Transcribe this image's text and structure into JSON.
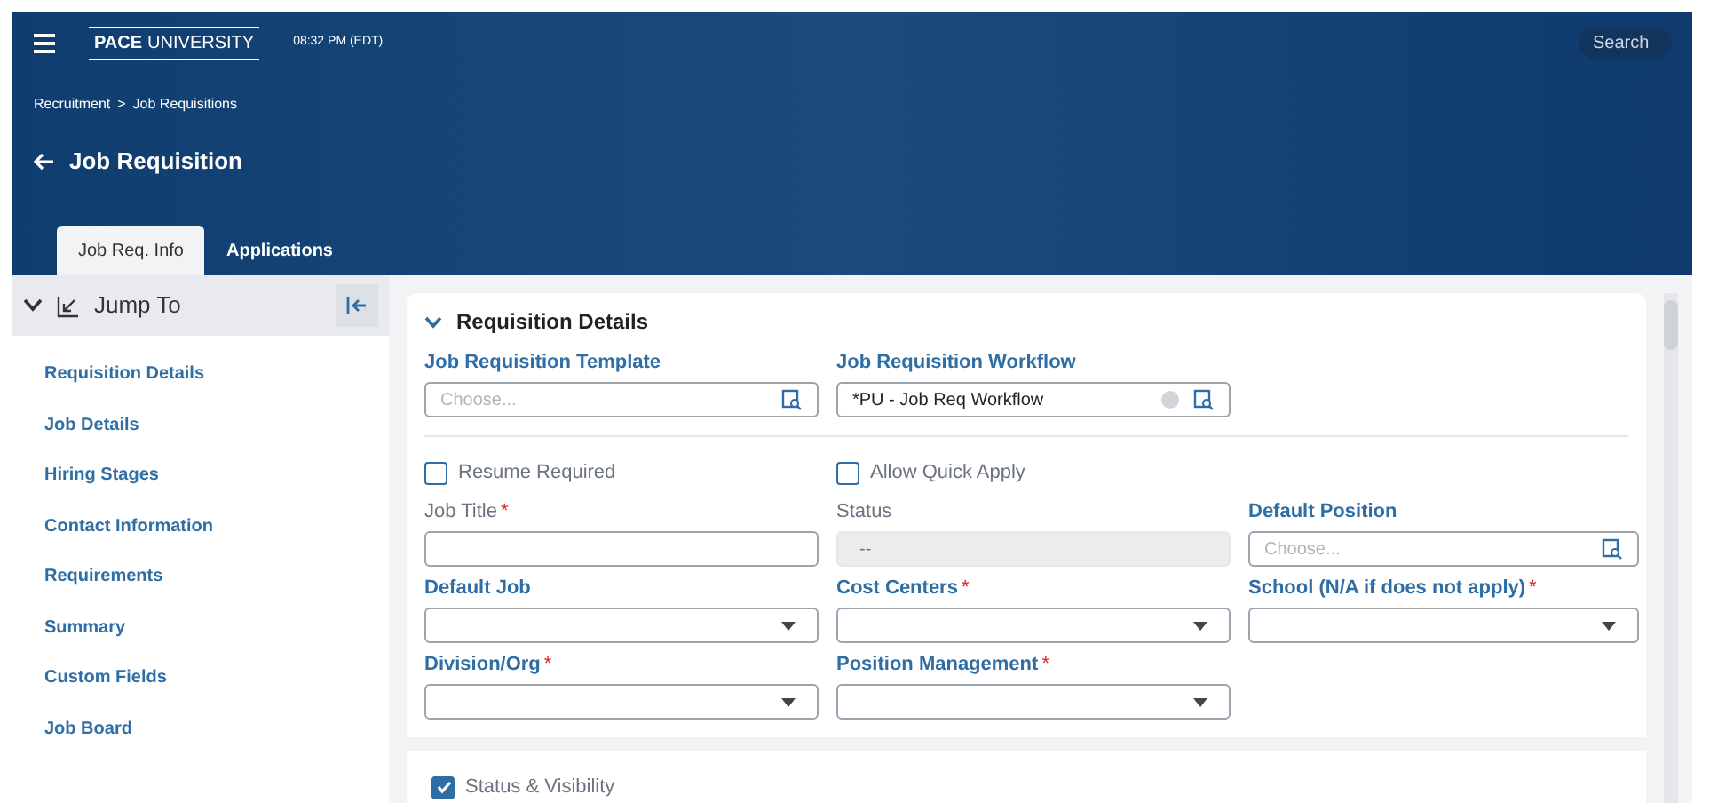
{
  "header": {
    "logo_bold": "PACE",
    "logo_rest": "UNIVERSITY",
    "time": "08:32 PM (EDT)",
    "search": {
      "placeholder": "Search"
    },
    "breadcrumb": [
      "Recruitment",
      ">",
      "Job Requisitions"
    ],
    "title": "Job Requisition"
  },
  "tabs": [
    {
      "label": "Job Req. Info",
      "selected": true
    },
    {
      "label": "Applications",
      "selected": false
    }
  ],
  "sidebar": {
    "title": "Jump To",
    "expanded": true,
    "items": [
      "Requisition Details",
      "Job Details",
      "Hiring Stages",
      "Contact Information",
      "Requirements",
      "Summary",
      "Custom Fields",
      "Job Board"
    ]
  },
  "section": {
    "title": "Requisition Details",
    "expanded": true,
    "rows": [
      [
        {
          "kind": "lookup",
          "label": "Job Requisition Template",
          "bold": true,
          "placeholder": "Choose..."
        },
        {
          "kind": "lookup",
          "label": "Job Requisition Workflow",
          "bold": true,
          "value": "*PU - Job Req Workflow",
          "clearable": true
        }
      ],
      [
        {
          "kind": "checkbox",
          "label": "Resume Required",
          "checked": false
        },
        {
          "kind": "checkbox",
          "label": "Allow Quick Apply",
          "checked": false
        }
      ],
      [
        {
          "kind": "text",
          "label": "Job Title",
          "bold": false,
          "required_mark": "*"
        },
        {
          "kind": "readonly",
          "label": "Status",
          "bold": false,
          "value": "--"
        },
        {
          "kind": "lookup",
          "label": "Default Position",
          "bold": true,
          "placeholder": "Choose..."
        }
      ],
      [
        {
          "kind": "select",
          "label": "Default Job",
          "bold": true
        },
        {
          "kind": "select",
          "label": "Cost Centers",
          "bold": true,
          "required_mark": "*"
        },
        {
          "kind": "select",
          "label": "School (N/A if does not apply)",
          "bold": true,
          "required_mark": "*"
        }
      ],
      [
        {
          "kind": "select",
          "label": "Division/Org",
          "bold": true,
          "required_mark": "*"
        },
        {
          "kind": "select",
          "label": "Position Management",
          "bold": true,
          "required_mark": "*"
        }
      ]
    ]
  },
  "next_section": {
    "label": "Status & Visibility",
    "checked": true
  }
}
